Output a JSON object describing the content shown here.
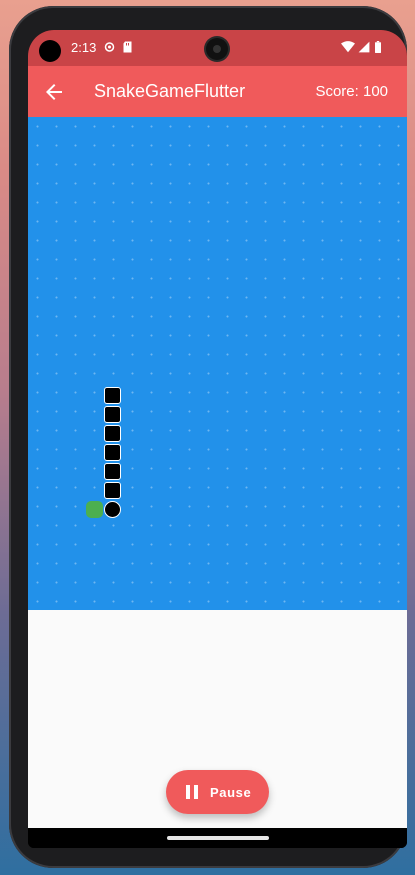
{
  "status_bar": {
    "time": "2:13",
    "icons": [
      "settings-icon",
      "sd-card-icon",
      "wifi-icon",
      "signal-icon",
      "battery-icon"
    ]
  },
  "app_bar": {
    "back_icon": "arrow-back-icon",
    "title": "SnakeGameFlutter",
    "score_text": "Score: 100"
  },
  "game": {
    "snake_segments": 6,
    "food_color": "#4caf50",
    "board_color": "#2291ea"
  },
  "controls": {
    "pause_icon": "pause-icon",
    "pause_label": "Pause"
  },
  "colors": {
    "status_bar": "#c94447",
    "app_bar": "#f05a5b",
    "accent": "#f05a5b"
  }
}
